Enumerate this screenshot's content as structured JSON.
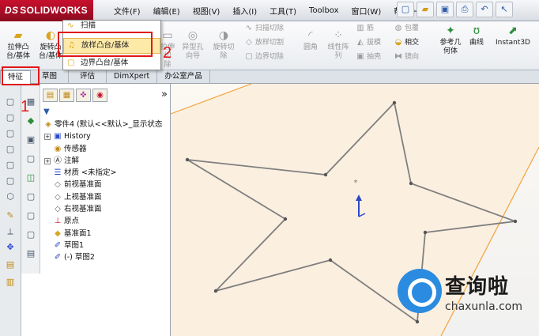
{
  "app": {
    "logo_prefix": "DS",
    "logo_text": "SOLIDWORKS"
  },
  "menu": [
    "文件(F)",
    "编辑(E)",
    "视图(V)",
    "插入(I)",
    "工具(T)",
    "Toolbox",
    "窗口(W)",
    "帮助(H)"
  ],
  "ribbon": {
    "extrude_boss": "拉伸凸\n台/基体",
    "revolve_boss": "旋转凸\n台/基体",
    "sweep": "扫描",
    "loft_boss_menu": "放样凸台/基体",
    "boundary_boss": "边界凸台/基体",
    "extrude_cut": "拉伸切\n除",
    "hole_wizard": "异型孔\n向导",
    "revolve_cut": "旋转切\n除",
    "swept_cut": "扫描切除",
    "lofted_cut": "放样切割",
    "boundary_cut": "边界切除",
    "fillet": "圆角",
    "linear_pattern": "线性阵\n列",
    "rib": "筋",
    "draft": "拔模",
    "shell": "抽壳",
    "wrap": "包覆",
    "intersect": "相交",
    "mirror": "镜向",
    "ref_geometry": "参考几\n何体",
    "curves": "曲线",
    "instant3d": "Instant3D"
  },
  "tabs": [
    "特征",
    "草图",
    "评估",
    "DimXpert",
    "办公室产品"
  ],
  "annotations": {
    "one": "1",
    "two": "2"
  },
  "feature_tree": {
    "root": "零件4 (默认<<默认>_显示状态",
    "items": [
      "History",
      "传感器",
      "注解",
      "材质 <未指定>",
      "前视基准面",
      "上视基准面",
      "右视基准面",
      "原点",
      "基准面1",
      "草图1",
      "(-) 草图2"
    ]
  },
  "watermark": {
    "text": "查询啦",
    "url": "chaxunla.com"
  },
  "colors": {
    "brand": "#c8102e",
    "highlight_box": "#e01818",
    "plane_edge": "#f2a33a",
    "axis_y": "#2c49c8"
  },
  "icons": [
    "new-icon",
    "open-icon",
    "save-icon",
    "print-icon",
    "undo-icon",
    "select-icon"
  ]
}
